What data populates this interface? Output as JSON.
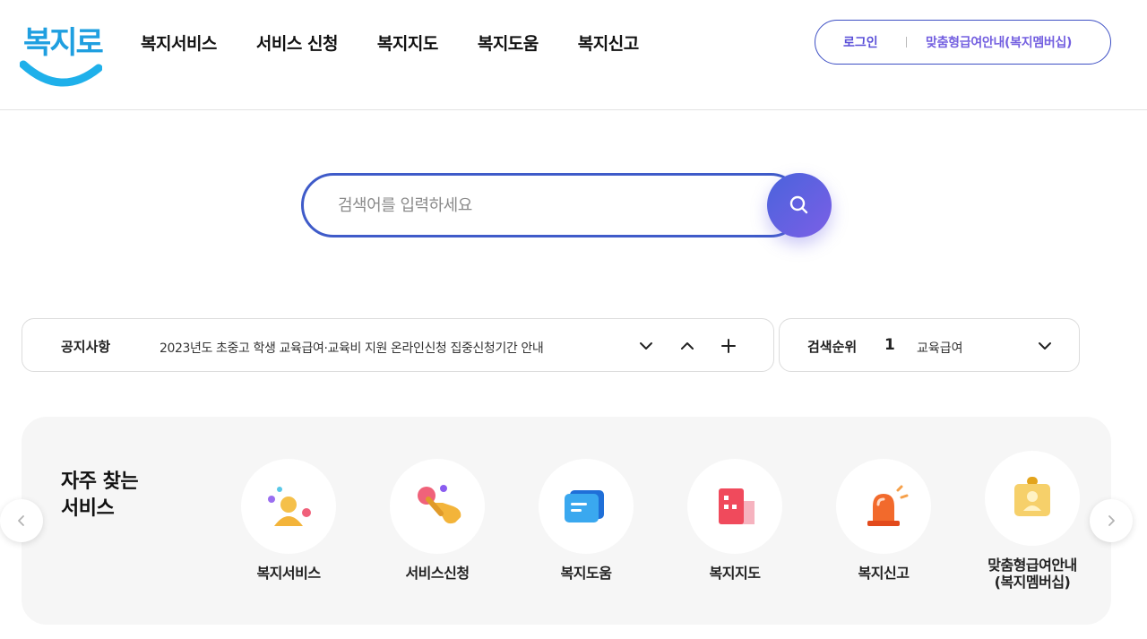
{
  "logo": {
    "text": "복지로"
  },
  "nav": [
    {
      "label": "복지서비스"
    },
    {
      "label": "서비스 신청"
    },
    {
      "label": "복지지도"
    },
    {
      "label": "복지도움"
    },
    {
      "label": "복지신고"
    }
  ],
  "user": {
    "login": "로그인",
    "membership": "맞춤형급여안내(복지멤버십)"
  },
  "search": {
    "placeholder": "검색어를 입력하세요"
  },
  "notice": {
    "label": "공지사항",
    "text": "2023년도 초중고 학생 교육급여·교육비 지원 온라인신청 집중신청기간 안내"
  },
  "ranking": {
    "label": "검색순위",
    "rank": "1",
    "term": "교육급여"
  },
  "frequent": {
    "title_line1": "자주 찾는",
    "title_line2": "서비스",
    "items": [
      {
        "label": "복지서비스",
        "icon": "person-icon"
      },
      {
        "label": "서비스신청",
        "icon": "hand-click-icon"
      },
      {
        "label": "복지도움",
        "icon": "chat-bubble-icon"
      },
      {
        "label": "복지지도",
        "icon": "building-icon"
      },
      {
        "label": "복지신고",
        "icon": "siren-icon"
      },
      {
        "label_line1": "맞춤형급여안내",
        "label_line2": "(복지멤버십)",
        "icon": "id-badge-icon"
      }
    ]
  },
  "colors": {
    "brand_blue": "#3f5bc9",
    "accent_purple": "#7460e0",
    "logo_blue": "#1f9fe0"
  }
}
